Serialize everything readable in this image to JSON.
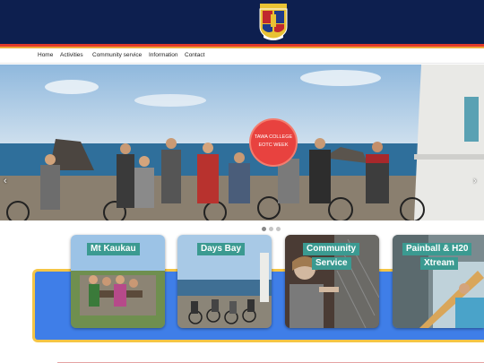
{
  "nav": {
    "items": [
      "Home",
      "Activities",
      "Community service",
      "Information",
      "Contact"
    ]
  },
  "hero": {
    "badge_line1": "TAWA COLLEGE",
    "badge_line2": "EOTC WEEK",
    "prev_glyph": "‹",
    "next_glyph": "›",
    "slide_count": 3,
    "active_slide": 1
  },
  "cards": [
    {
      "label": "Mt Kaukau"
    },
    {
      "label": "Days Bay"
    },
    {
      "label_line1": "Community",
      "label_line2": "Service"
    },
    {
      "label_line1": "Painball & H20",
      "label_line2": "Xtream"
    }
  ],
  "colors": {
    "header": "#0d1f4f",
    "accent_red": "#e33a2a",
    "accent_orange": "#f0a93a",
    "band_blue": "#3f7ee8",
    "band_border": "#f5c545",
    "label_teal": "#3b9a91"
  }
}
